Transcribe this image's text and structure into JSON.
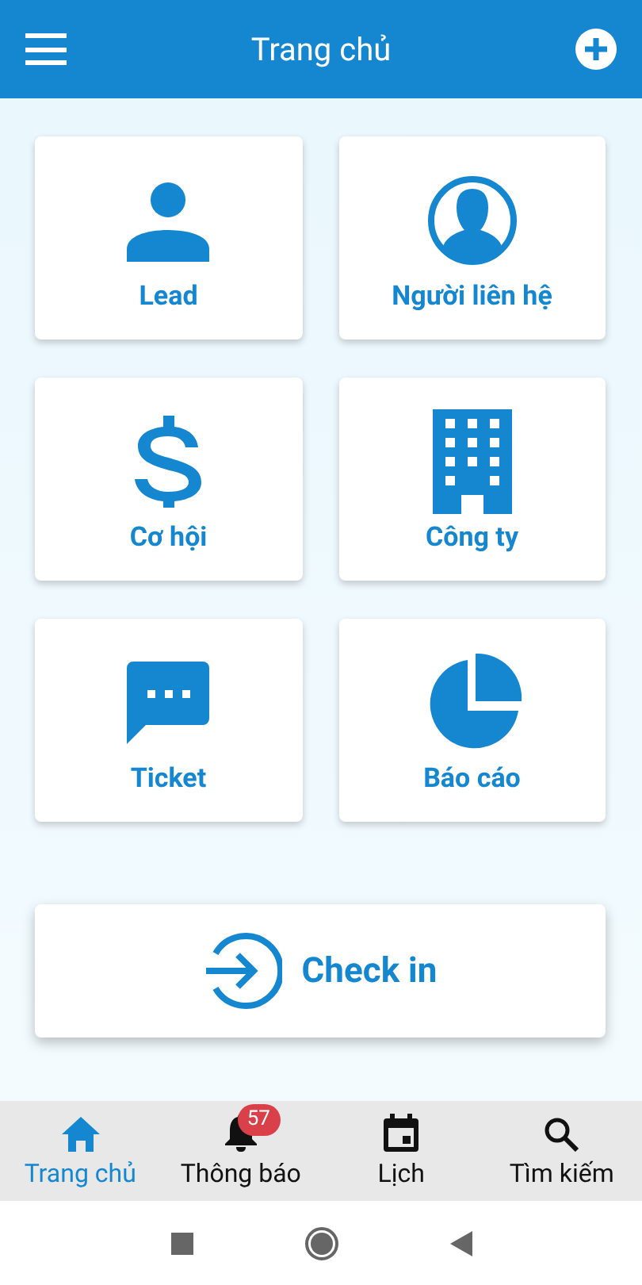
{
  "header": {
    "title": "Trang chủ"
  },
  "tiles": [
    {
      "kind": "person",
      "label": "Lead"
    },
    {
      "kind": "contact",
      "label": "Người liên hệ"
    },
    {
      "kind": "dollar",
      "label": "Cơ hội"
    },
    {
      "kind": "building",
      "label": "Công ty"
    },
    {
      "kind": "chat",
      "label": "Ticket"
    },
    {
      "kind": "pie",
      "label": "Báo cáo"
    }
  ],
  "checkin": {
    "label": "Check in"
  },
  "bottom_nav": [
    {
      "kind": "home",
      "label": "Trang chủ",
      "selected": true
    },
    {
      "kind": "bell",
      "label": "Thông báo",
      "selected": false,
      "badge": "57"
    },
    {
      "kind": "calendar",
      "label": "Lịch",
      "selected": false
    },
    {
      "kind": "search",
      "label": "Tìm kiếm",
      "selected": false
    }
  ]
}
